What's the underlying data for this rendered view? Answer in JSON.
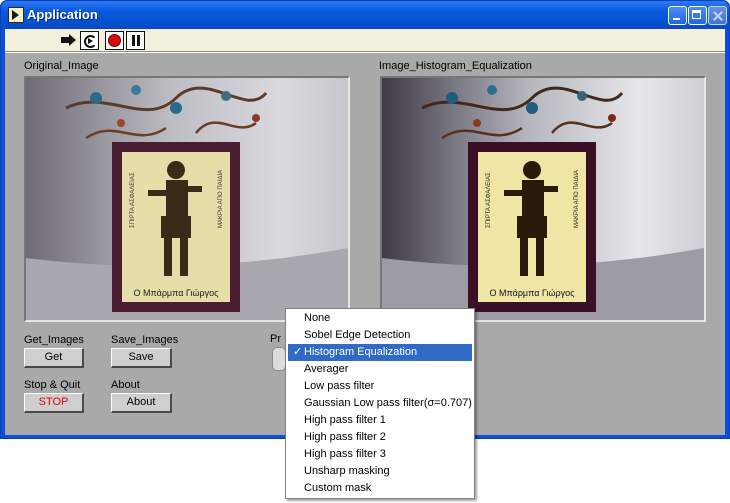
{
  "window": {
    "title": "Application"
  },
  "toolbar": {
    "run": "run-arrow-icon",
    "continuous": "run-continuously-icon",
    "abort": "abort-execution-icon",
    "pause": "pause-icon"
  },
  "images": {
    "original_label": "Original_Image",
    "processed_label": "Image_Histogram_Equalization",
    "card_caption": "Ο Μπάρμπα Γιώργος",
    "card_side_left": "ΣΠΙΡΤΑ ΑΣΦΑΛΕΙΑΣ",
    "card_side_right": "ΜΑΚΡΙΑ ΑΠΟ ΠΑΙΔΙΑ"
  },
  "controls": {
    "get_images_label": "Get_Images",
    "get_button": "Get",
    "save_images_label": "Save_Images",
    "save_button": "Save",
    "stop_quit_label": "Stop & Quit",
    "stop_button": "STOP",
    "about_label": "About",
    "about_button": "About",
    "processing_label_partial": "Pr"
  },
  "menu": {
    "selected_index": 2,
    "check_glyph": "✓",
    "items": [
      "None",
      "Sobel Edge Detection",
      "Histogram Equalization",
      "Averager",
      "Low pass filter",
      "Gaussian Low pass filter(σ=0.707)",
      "High pass filter 1",
      "High pass filter 2",
      "High pass filter 3",
      "Unsharp masking",
      "Custom mask"
    ]
  },
  "colors": {
    "titlebar": "#0b5bdf",
    "panel": "#a9a9a9",
    "menu_highlight": "#316ac5",
    "stop_text": "#e00000"
  }
}
